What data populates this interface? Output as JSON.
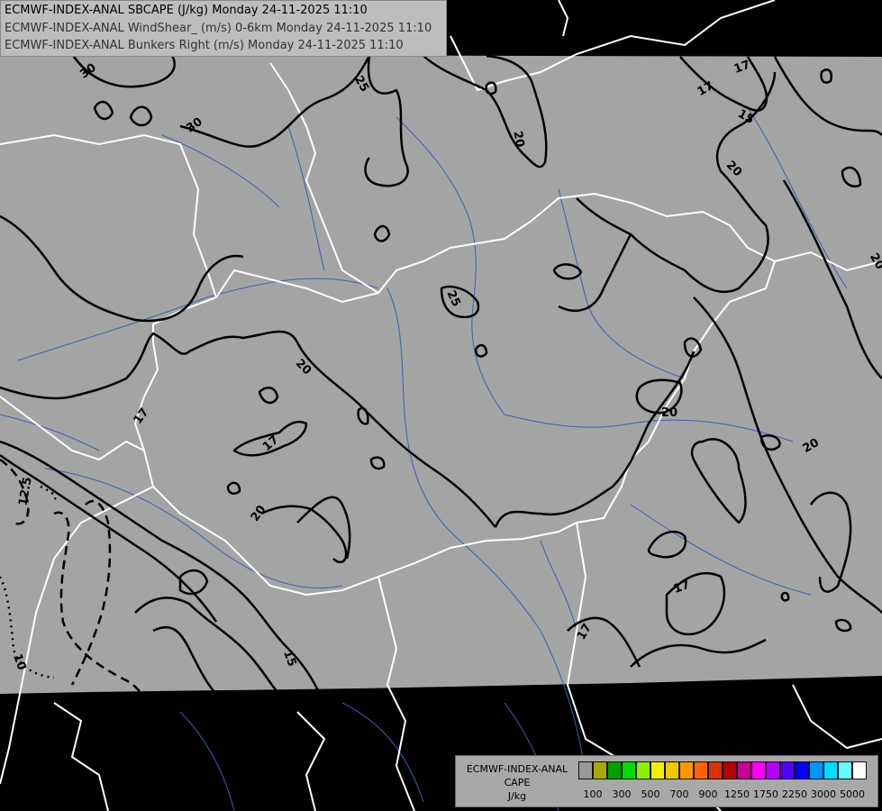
{
  "title_lines": [
    "ECMWF-INDEX-ANAL SBCAPE (J/kg) Monday 24-11-2025 11:10",
    "ECMWF-INDEX-ANAL WindShear_ (m/s) 0-6km Monday 24-11-2025 11:10",
    "ECMWF-INDEX-ANAL Bunkers Right (m/s) Monday 24-11-2025 11:10"
  ],
  "legend": {
    "line1": "ECMWF-INDEX-ANAL",
    "line2": "CAPE",
    "line3": "J/kg",
    "colors": [
      "#999999",
      "#a8a800",
      "#00a000",
      "#00dc00",
      "#8cf000",
      "#f0f000",
      "#f0c800",
      "#ff9600",
      "#ff6400",
      "#dc3200",
      "#b40000",
      "#c80096",
      "#ff00ff",
      "#b400ff",
      "#5000ff",
      "#0000ff",
      "#0096ff",
      "#00dcff",
      "#64ffff",
      "#ffffff"
    ],
    "ticks": [
      "100",
      "300",
      "500",
      "700",
      "900",
      "1250",
      "1750",
      "2250",
      "3000",
      "5000"
    ]
  },
  "contour_labels": [
    "30",
    "30",
    "25",
    "20",
    "20",
    "17",
    "15",
    "20",
    "17",
    "25",
    "20",
    "20",
    "20",
    "17",
    "20",
    "17",
    "17",
    "12.5",
    "10",
    "15",
    "17"
  ],
  "map_colors": {
    "background": "#000000",
    "field": "#a4a4a4",
    "borders": "#ffffff",
    "rivers": "#3a5fb4",
    "contours": "#000000"
  }
}
